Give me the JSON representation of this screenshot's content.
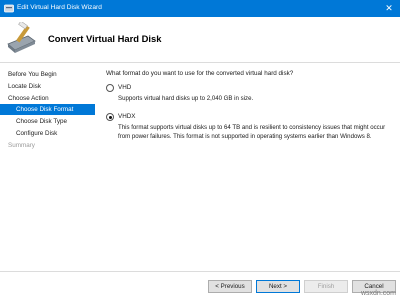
{
  "window": {
    "title": "Edit Virtual Hard Disk Wizard",
    "close_glyph": "✕",
    "app_icon": "disk-app-icon"
  },
  "header": {
    "heading": "Convert Virtual Hard Disk",
    "icon": "wizard-disk-icon"
  },
  "sidebar": {
    "items": [
      {
        "label": "Before You Begin",
        "state": "normal"
      },
      {
        "label": "Locate Disk",
        "state": "normal"
      },
      {
        "label": "Choose Action",
        "state": "normal"
      },
      {
        "label": "Choose Disk Format",
        "state": "active"
      },
      {
        "label": "Choose Disk Type",
        "state": "normal"
      },
      {
        "label": "Configure Disk",
        "state": "normal"
      },
      {
        "label": "Summary",
        "state": "muted"
      }
    ]
  },
  "main": {
    "question": "What format do you want to use for the converted virtual hard disk?",
    "options": [
      {
        "label": "VHD",
        "description": "Supports virtual hard disks up to 2,040 GB in size.",
        "selected": false
      },
      {
        "label": "VHDX",
        "description": "This format supports virtual disks up to 64 TB and is resilient to consistency issues that might occur from power failures. This format is not supported in operating systems earlier than Windows 8.",
        "selected": true
      }
    ]
  },
  "buttons": {
    "previous": "< Previous",
    "next": "Next >",
    "finish": "Finish",
    "cancel": "Cancel"
  },
  "watermark": "wsxdn.com",
  "colors": {
    "accent": "#0078d7",
    "titlebar": "#0078d7"
  }
}
